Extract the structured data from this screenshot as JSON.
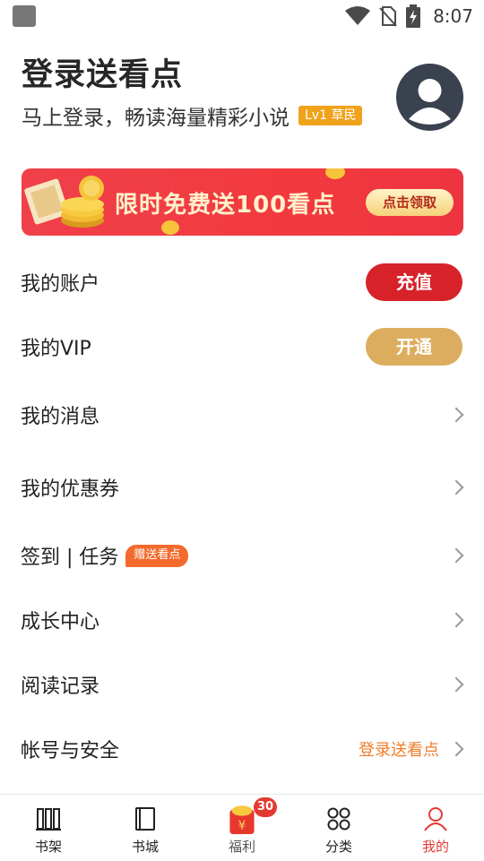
{
  "status_bar": {
    "time": "8:07"
  },
  "header": {
    "title": "登录送看点",
    "subtitle": "马上登录，畅读海量精彩小说",
    "level_badge": "Lv1 草民"
  },
  "banner": {
    "text": "限时免费送100看点",
    "button_label": "点击领取"
  },
  "menu": {
    "account": {
      "label": "我的账户",
      "button": "充值"
    },
    "vip": {
      "label": "我的VIP",
      "button": "开通"
    },
    "messages": {
      "label": "我的消息"
    },
    "coupons": {
      "label": "我的优惠券"
    },
    "tasks": {
      "label": "签到 | 任务",
      "badge": "赠送看点"
    },
    "growth": {
      "label": "成长中心"
    },
    "history": {
      "label": "阅读记录"
    },
    "security": {
      "label": "帐号与安全",
      "hint": "登录送看点"
    }
  },
  "tabbar": {
    "tabs": [
      {
        "label": "书架",
        "icon": "bookshelf-icon"
      },
      {
        "label": "书城",
        "icon": "book-icon"
      },
      {
        "label": "福利",
        "icon": "red-envelope-icon",
        "badge": "30"
      },
      {
        "label": "分类",
        "icon": "grid-icon"
      },
      {
        "label": "我的",
        "icon": "profile-icon",
        "active": true
      }
    ]
  },
  "colors": {
    "accent_red": "#d7222a",
    "vip_gold": "#ddad5f",
    "hint_orange": "#f07d2a",
    "active_tab": "#e33b33"
  }
}
